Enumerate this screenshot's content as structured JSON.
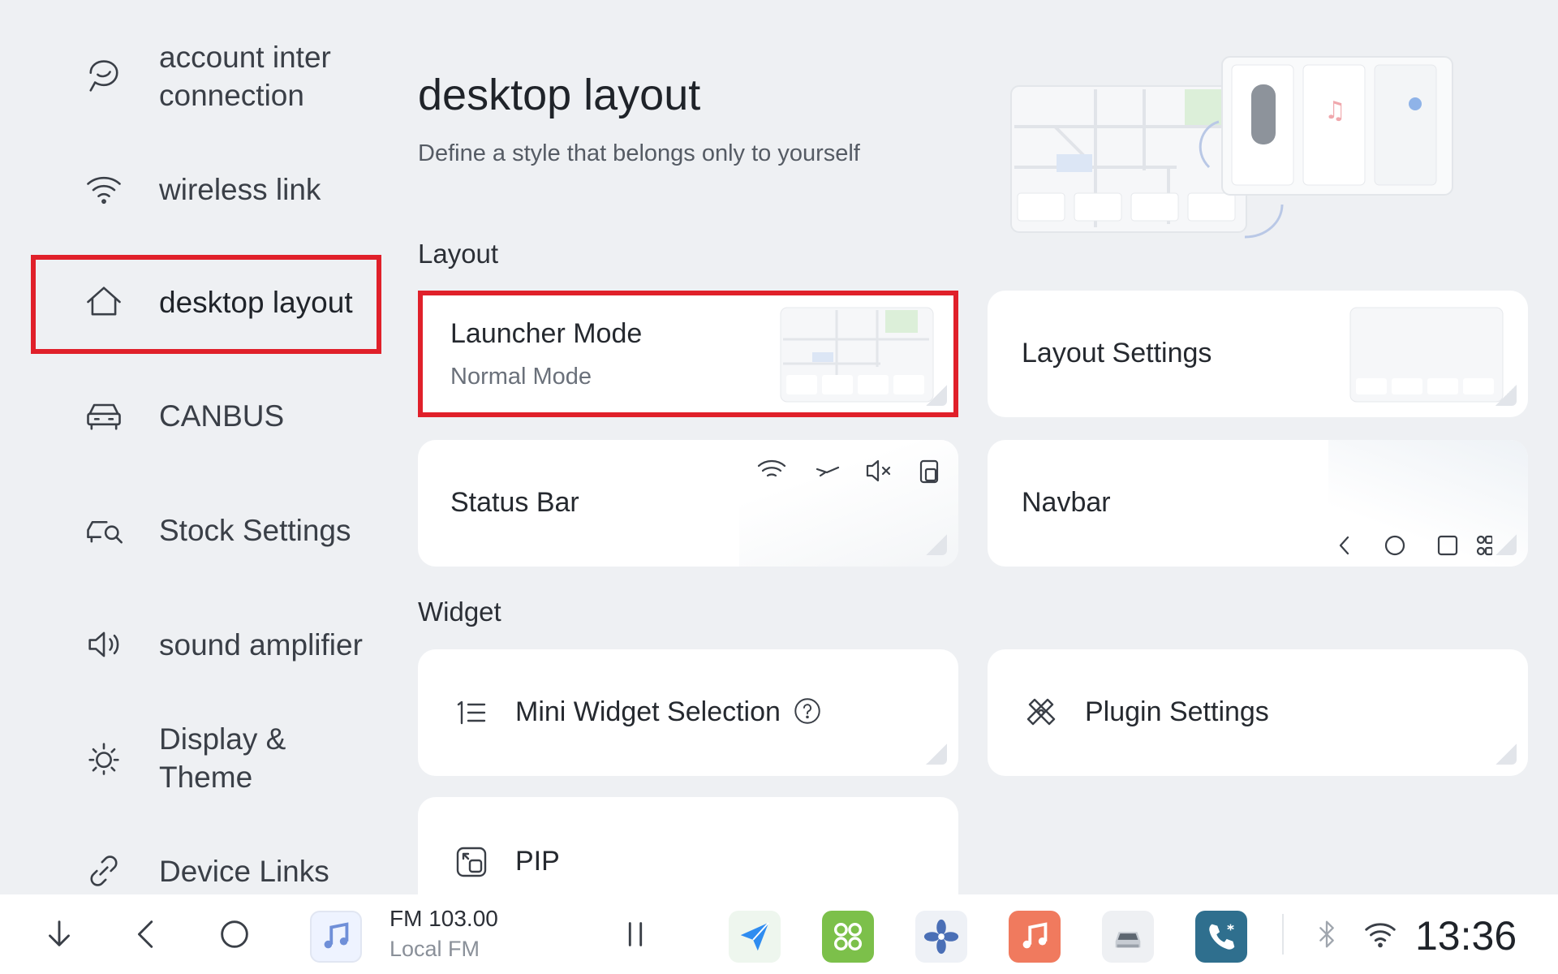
{
  "sidebar": {
    "items": [
      {
        "label": "account inter connection",
        "icon": "account-link-icon"
      },
      {
        "label": "wireless link",
        "icon": "wifi-icon"
      },
      {
        "label": "desktop layout",
        "icon": "home-icon",
        "active": true
      },
      {
        "label": "CANBUS",
        "icon": "car-icon"
      },
      {
        "label": "Stock Settings",
        "icon": "car-wrench-icon"
      },
      {
        "label": "sound amplifier",
        "icon": "speaker-icon"
      },
      {
        "label": "Display & Theme",
        "icon": "sun-icon"
      },
      {
        "label": "Device Links",
        "icon": "link-icon"
      }
    ]
  },
  "main": {
    "title": "desktop layout",
    "subtitle": "Define a style that belongs only to yourself",
    "sections": {
      "layout": "Layout",
      "widget": "Widget"
    },
    "cards": {
      "launcher_mode": {
        "title": "Launcher Mode",
        "value": "Normal Mode"
      },
      "layout_settings": {
        "title": "Layout Settings"
      },
      "status_bar": {
        "title": "Status Bar"
      },
      "navbar": {
        "title": "Navbar"
      },
      "mini_widget": {
        "title": "Mini Widget Selection"
      },
      "plugin_settings": {
        "title": "Plugin Settings"
      },
      "pip": {
        "title": "PIP"
      }
    }
  },
  "taskbar": {
    "media": {
      "title": "FM 103.00",
      "subtitle": "Local FM"
    },
    "clock": "13:36",
    "apps": [
      "navigation-icon",
      "apps-grid-icon",
      "fan-icon",
      "music-icon",
      "car-settings-icon",
      "phone-icon"
    ]
  },
  "colors": {
    "background": "#eef0f3",
    "card": "#ffffff",
    "highlight": "#e0202a"
  }
}
